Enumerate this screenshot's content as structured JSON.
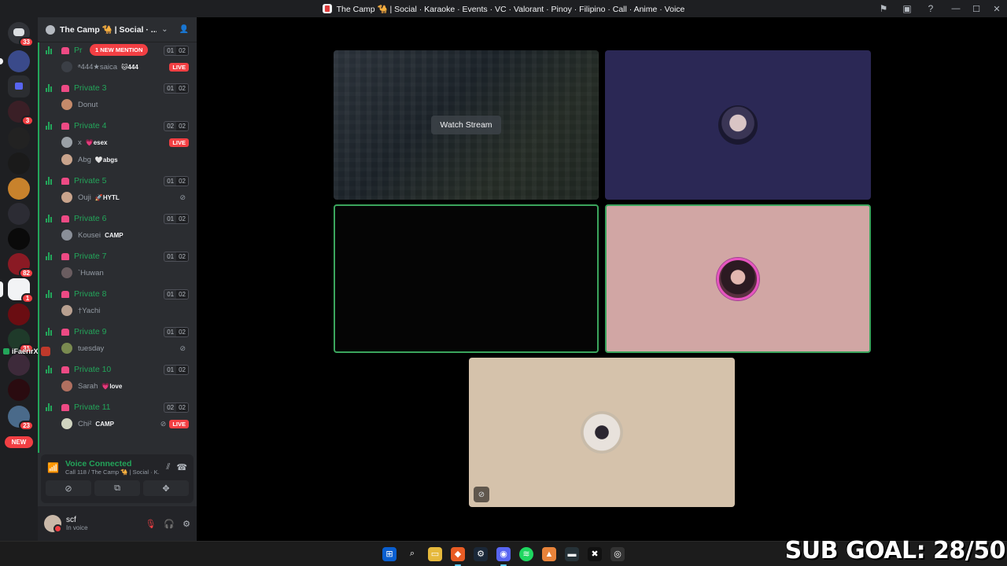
{
  "window": {
    "title": "The Camp 🐪 | Social · Karaoke · Events · VC · Valorant · Pinoy · Filipino · Call · Anime · Voice",
    "controls": [
      "minimize",
      "maximize",
      "close"
    ]
  },
  "rail": {
    "dm_badge": "33",
    "servers": [
      {
        "badge": ""
      },
      {
        "badge": ""
      },
      {
        "badge": "3"
      },
      {
        "badge": ""
      },
      {
        "badge": ""
      },
      {
        "badge": ""
      },
      {
        "badge": ""
      },
      {
        "badge": ""
      },
      {
        "badge": "82"
      },
      {
        "badge": "1"
      },
      {
        "badge": ""
      },
      {
        "badge": "31"
      },
      {
        "badge": ""
      },
      {
        "badge": ""
      },
      {
        "badge": "23"
      }
    ],
    "new_label": "NEW",
    "overlay_user": "iFaerirX"
  },
  "guild": {
    "name": "The Camp 🐪 | Social · ...",
    "mention_label": "1 NEW MENTION"
  },
  "channels": [
    {
      "name": "Pr",
      "count_a": "01",
      "count_b": "02",
      "members": [
        {
          "name": "ᵃ444★saica",
          "tag": "🐱444",
          "live": true
        }
      ]
    },
    {
      "name": "Private 3",
      "count_a": "01",
      "count_b": "02",
      "members": [
        {
          "name": "Donut",
          "tag": "",
          "live": false
        }
      ]
    },
    {
      "name": "Private 4",
      "count_a": "02",
      "count_b": "02",
      "members": [
        {
          "name": "x",
          "tag": "💗esex",
          "live": true
        },
        {
          "name": "Abg",
          "tag": "🤍abgs",
          "live": false
        }
      ]
    },
    {
      "name": "Private 5",
      "count_a": "01",
      "count_b": "02",
      "members": [
        {
          "name": "Ouji",
          "tag": "🚀HYTL",
          "live": false,
          "muted": true
        }
      ]
    },
    {
      "name": "Private 6",
      "count_a": "01",
      "count_b": "02",
      "members": [
        {
          "name": "Kousei",
          "tag": "CAMP",
          "live": false
        }
      ]
    },
    {
      "name": "Private 7",
      "count_a": "01",
      "count_b": "02",
      "members": [
        {
          "name": "`Huwan",
          "tag": "",
          "live": false
        }
      ]
    },
    {
      "name": "Private 8",
      "count_a": "01",
      "count_b": "02",
      "members": [
        {
          "name": "†Yachi",
          "tag": "",
          "live": false
        }
      ]
    },
    {
      "name": "Private 9",
      "count_a": "01",
      "count_b": "02",
      "members": [
        {
          "name": "tuesday",
          "tag": "",
          "live": false,
          "muted": true
        }
      ]
    },
    {
      "name": "Private 10",
      "count_a": "01",
      "count_b": "02",
      "members": [
        {
          "name": "Sarah",
          "tag": "💗love",
          "live": false
        }
      ]
    },
    {
      "name": "Private 11",
      "count_a": "02",
      "count_b": "02",
      "members": [
        {
          "name": "Chi²",
          "tag": "CAMP",
          "live": true,
          "muted": true
        }
      ]
    }
  ],
  "live_label": "LIVE",
  "voice": {
    "status": "Voice Connected",
    "subtitle": "Call 118 / The Camp 🐪 | Social · K..."
  },
  "user": {
    "name": "scf",
    "status": "In voice"
  },
  "stage": {
    "watch_label": "Watch Stream"
  },
  "overlay": {
    "subgoal": "SUB GOAL: 28/50"
  },
  "colors": {
    "accent_green": "#23a55a",
    "danger": "#f23f43",
    "tile_purple": "#2b2855",
    "tile_pink": "#d1a6a4",
    "tile_beige": "#d5c2ab"
  }
}
